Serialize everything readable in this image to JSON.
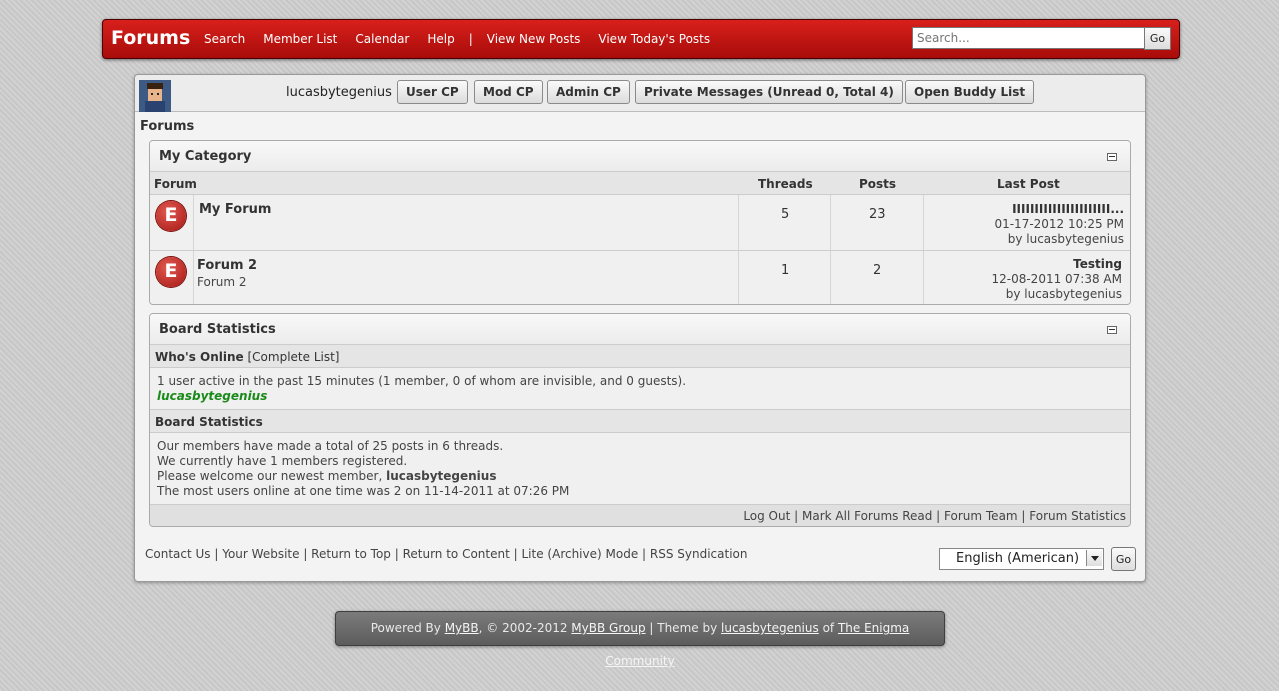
{
  "header": {
    "logo": "Forums",
    "nav": [
      "Search",
      "Member List",
      "Calendar",
      "Help"
    ],
    "nav_separator": "|",
    "nav2": [
      "View New Posts",
      "View Today's Posts"
    ],
    "search_placeholder": "Search...",
    "search_go": "Go"
  },
  "userbar": {
    "username": "lucasbytegenius",
    "buttons": [
      "User CP",
      "Mod CP",
      "Admin CP",
      "Private Messages (Unread 0, Total 4)",
      "Open Buddy List"
    ]
  },
  "breadcrumb": "Forums",
  "category": {
    "title": "My Category",
    "columns": {
      "forum": "Forum",
      "threads": "Threads",
      "posts": "Posts",
      "last_post": "Last Post"
    },
    "forums": [
      {
        "icon_letter": "E",
        "name": "My Forum",
        "description": "",
        "threads": "5",
        "posts": "23",
        "last_title": "IIIIIIIIIIIIIIIIIIIIII...",
        "last_date": "01-17-2012 10:25 PM",
        "last_by": "by lucasbytegenius"
      },
      {
        "icon_letter": "E",
        "name": "Forum 2",
        "description": "Forum 2",
        "threads": "1",
        "posts": "2",
        "last_title": "Testing",
        "last_date": "12-08-2011 07:38 AM",
        "last_by": "by lucasbytegenius"
      }
    ]
  },
  "stats": {
    "title": "Board Statistics",
    "whos_online_label": "Who's Online",
    "complete_list": "[Complete List]",
    "active_text": "1 user active in the past 15 minutes (1 member, 0 of whom are invisible, and 0 guests).",
    "online_user": "lucasbytegenius",
    "stats_heading": "Board Statistics",
    "line1": "Our members have made a total of 25 posts in 6 threads.",
    "line2": "We currently have 1 members registered.",
    "line3_prefix": "Please welcome our newest member, ",
    "line3_user": "lucasbytegenius",
    "line4": "The most users online at one time was 2 on 11-14-2011 at 07:26 PM",
    "footer_links": [
      "Log Out",
      "Mark All Forums Read",
      "Forum Team",
      "Forum Statistics"
    ]
  },
  "footer": {
    "links": [
      "Contact Us",
      "Your Website",
      "Return to Top",
      "Return to Content",
      "Lite (Archive) Mode",
      "RSS Syndication"
    ],
    "language": "English (American)",
    "language_go": "Go"
  },
  "powered": {
    "prefix": "Powered By ",
    "mybb": "MyBB",
    "mid": ", © 2002-2012 ",
    "group": "MyBB Group",
    "theme_by": " | Theme by ",
    "author": "lucasbytegenius",
    "of": " of ",
    "community": "The Enigma Community"
  }
}
